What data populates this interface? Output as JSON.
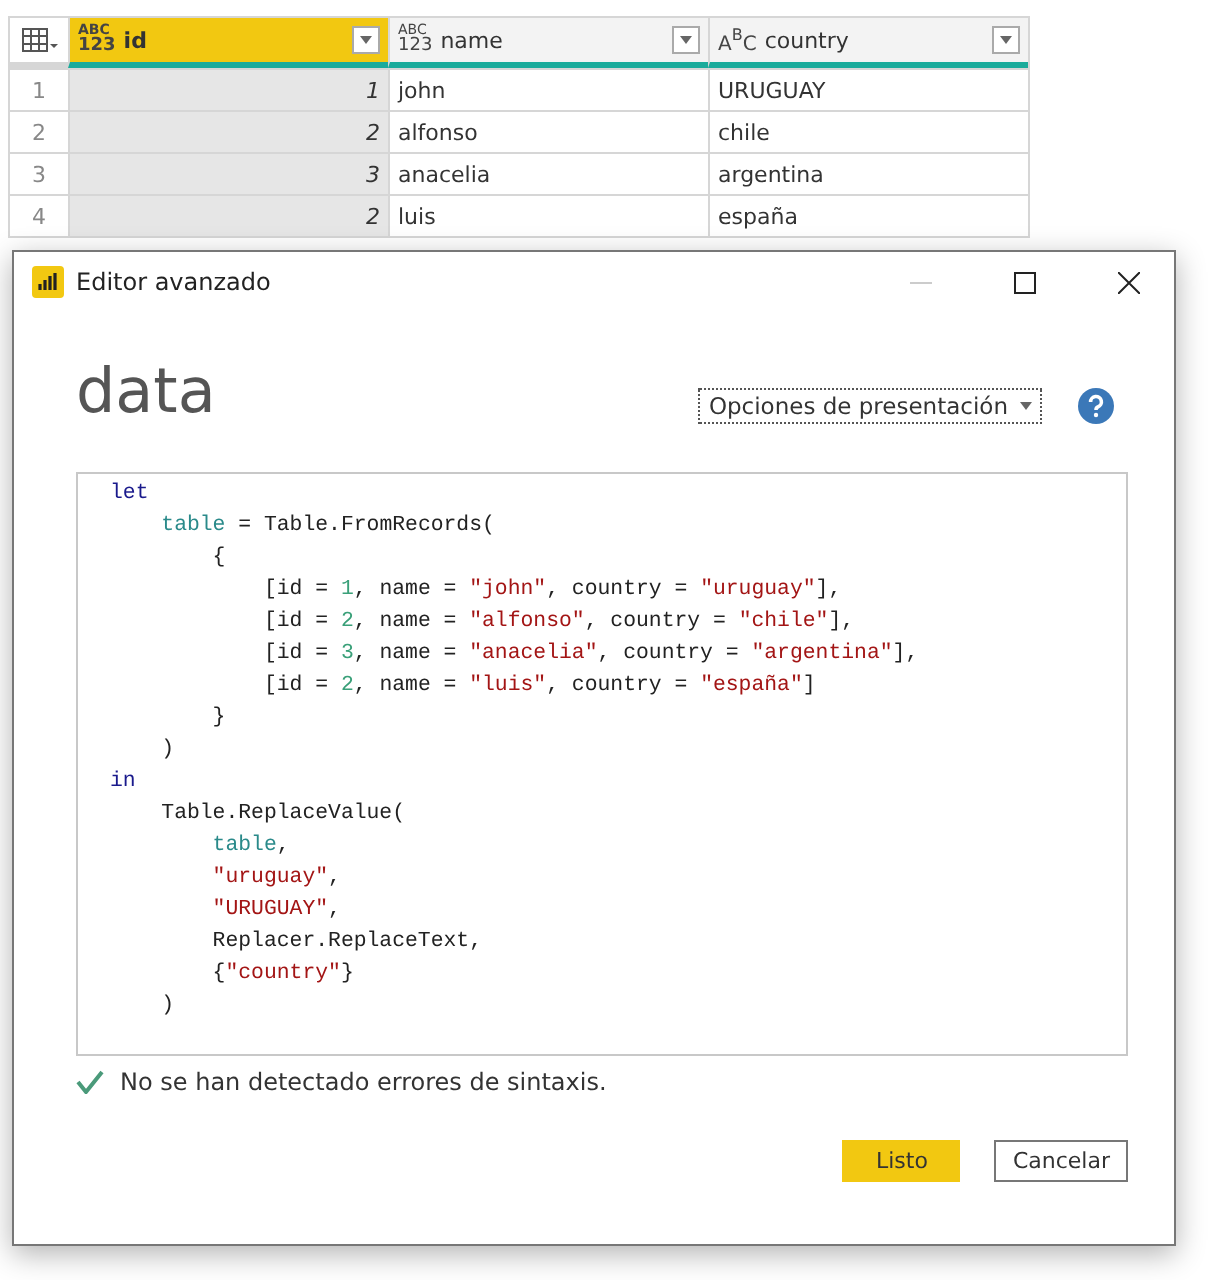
{
  "table": {
    "columns": [
      {
        "label": "id",
        "kind": "any",
        "type_glyph": [
          "ABC",
          "123"
        ],
        "selected": true
      },
      {
        "label": "name",
        "kind": "any",
        "type_glyph": [
          "ABC",
          "123"
        ],
        "selected": false
      },
      {
        "label": "country",
        "kind": "text",
        "type_glyph": [
          "A",
          "B",
          "C"
        ],
        "selected": false
      }
    ],
    "rows": [
      {
        "number": "1",
        "cells": [
          "1",
          "john",
          "URUGUAY"
        ]
      },
      {
        "number": "2",
        "cells": [
          "2",
          "alfonso",
          "chile"
        ]
      },
      {
        "number": "3",
        "cells": [
          "3",
          "anacelia",
          "argentina"
        ]
      },
      {
        "number": "4",
        "cells": [
          "2",
          "luis",
          "españa"
        ]
      }
    ]
  },
  "dialog": {
    "title": "Editor avanzado",
    "query_name": "data",
    "display_options": "Opciones de presentación",
    "code": [
      [
        {
          "kind": "keyword",
          "text": "let"
        }
      ],
      [
        {
          "kind": "variable",
          "text": "    table"
        },
        {
          "kind": "plain",
          "text": " = Table.FromRecords("
        }
      ],
      [
        {
          "kind": "plain",
          "text": "        {"
        }
      ],
      [
        {
          "kind": "plain",
          "text": "            [id = "
        },
        {
          "kind": "number",
          "text": "1"
        },
        {
          "kind": "plain",
          "text": ", name = "
        },
        {
          "kind": "string",
          "text": "\"john\""
        },
        {
          "kind": "plain",
          "text": ", country = "
        },
        {
          "kind": "string",
          "text": "\"uruguay\""
        },
        {
          "kind": "plain",
          "text": "],"
        }
      ],
      [
        {
          "kind": "plain",
          "text": "            [id = "
        },
        {
          "kind": "number",
          "text": "2"
        },
        {
          "kind": "plain",
          "text": ", name = "
        },
        {
          "kind": "string",
          "text": "\"alfonso\""
        },
        {
          "kind": "plain",
          "text": ", country = "
        },
        {
          "kind": "string",
          "text": "\"chile\""
        },
        {
          "kind": "plain",
          "text": "],"
        }
      ],
      [
        {
          "kind": "plain",
          "text": "            [id = "
        },
        {
          "kind": "number",
          "text": "3"
        },
        {
          "kind": "plain",
          "text": ", name = "
        },
        {
          "kind": "string",
          "text": "\"anacelia\""
        },
        {
          "kind": "plain",
          "text": ", country = "
        },
        {
          "kind": "string",
          "text": "\"argentina\""
        },
        {
          "kind": "plain",
          "text": "],"
        }
      ],
      [
        {
          "kind": "plain",
          "text": "            [id = "
        },
        {
          "kind": "number",
          "text": "2"
        },
        {
          "kind": "plain",
          "text": ", name = "
        },
        {
          "kind": "string",
          "text": "\"luis\""
        },
        {
          "kind": "plain",
          "text": ", country = "
        },
        {
          "kind": "string",
          "text": "\"españa\""
        },
        {
          "kind": "plain",
          "text": "]"
        }
      ],
      [
        {
          "kind": "plain",
          "text": "        }"
        }
      ],
      [
        {
          "kind": "plain",
          "text": "    )"
        }
      ],
      [
        {
          "kind": "keyword",
          "text": "in"
        }
      ],
      [
        {
          "kind": "plain",
          "text": "    Table.ReplaceValue("
        }
      ],
      [
        {
          "kind": "variable",
          "text": "        table"
        },
        {
          "kind": "plain",
          "text": ","
        }
      ],
      [
        {
          "kind": "string",
          "text": "        \"uruguay\""
        },
        {
          "kind": "plain",
          "text": ","
        }
      ],
      [
        {
          "kind": "string",
          "text": "        \"URUGUAY\""
        },
        {
          "kind": "plain",
          "text": ","
        }
      ],
      [
        {
          "kind": "plain",
          "text": "        Replacer.ReplaceText,"
        }
      ],
      [
        {
          "kind": "plain",
          "text": "        {"
        },
        {
          "kind": "string",
          "text": "\"country\""
        },
        {
          "kind": "plain",
          "text": "}"
        }
      ],
      [
        {
          "kind": "plain",
          "text": "    )"
        }
      ]
    ],
    "status": {
      "ok": true,
      "message": "No se han detectado errores de sintaxis."
    },
    "buttons": [
      {
        "label": "Listo",
        "primary": true
      },
      {
        "label": "Cancelar",
        "primary": false
      }
    ]
  }
}
